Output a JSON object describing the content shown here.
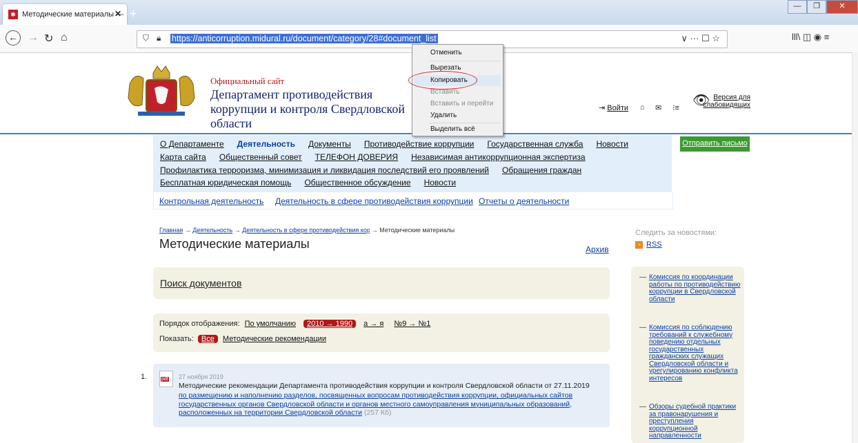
{
  "browser": {
    "tab_title": "Методические материалы —",
    "tab_close": "✕",
    "new_tab": "+",
    "url": "https://anticorruption.midural.ru/document/category/28#document_list",
    "url_right_icons": "∨  ···  ☐  ☆",
    "toolbar_right": "lll\\   ◫   ◉   ≡",
    "win_min": "—",
    "win_max": "❐",
    "win_close": "✕"
  },
  "header": {
    "small_title": "Официальный сайт",
    "title": "Департамент противодействия коррупции и контроля Свердловской области",
    "login": "Войти",
    "vision_version": "Версия для слабовидящих"
  },
  "menu": {
    "row1": [
      "О Департаменте",
      "Деятельность",
      "Документы",
      "Противодействие коррупции",
      "Государственная служба",
      "Новости"
    ],
    "row2": [
      "Карта сайта",
      "Общественный совет",
      "ТЕЛЕФОН ДОВЕРИЯ",
      "Независимая антикоррупционная экспертиза"
    ],
    "row3": [
      "Профилактика терроризма, минимизация и ликвидация последствий его проявлений",
      "Обращения граждан"
    ],
    "row4": [
      "Бесплатная юридическая помощь",
      "Общественное обсуждение",
      "Новости"
    ],
    "sub": [
      "Контрольная деятельность",
      "Деятельность в сфере противодействия коррупции",
      "Отчеты о деятельности"
    ],
    "send_letter": "Отправить письмо"
  },
  "breadcrumb": {
    "home": "Главная",
    "arrow": "→",
    "activity": "Деятельность",
    "sphere": "Деятельность в сфере противодействия коррупции",
    "current": "Методические материалы"
  },
  "page": {
    "title": "Методические материалы",
    "archive": "Архив",
    "search": "Поиск документов",
    "order_label": "Порядок отображения:",
    "order_default": "По умолчанию",
    "order_years": "2010 → 1990",
    "order_alpha": "а → я",
    "order_num": "№9 → №1",
    "show_label": "Показать:",
    "show_all": "Все",
    "show_recommend": "Методические рекомендации"
  },
  "document": {
    "index": "1.",
    "pdf": "pdf",
    "date": "27 ноября 2019",
    "title": "Методические рекомендации Департамента противодействия коррупции и контроля Свердловской области от 27.11.2019",
    "link_text": "по размещению и наполнению разделов, посвященных вопросам противодействия коррупции, официальных сайтов государственных органов Свердловской области и органов местного самоуправления муниципальных образований, расположенных на территории Свердловской области",
    "size": "(257 Кб)"
  },
  "sidebar": {
    "follow": "Следить за новостями:",
    "rss": "RSS",
    "dash": "—",
    "items": [
      "Комиссия по координации работы по противодействию коррупции в Свердловской области",
      "Комиссия по соблюдению требований к служебному поведению отдельных государственных гражданских служащих Свердловской области и урегулированию конфликта интересов",
      "Обзоры судебной практики за правонарушения и преступления коррупционной направленности"
    ]
  },
  "context_menu": {
    "undo": "Отменить",
    "cut": "Вырезать",
    "copy": "Копировать",
    "paste": "Вставить",
    "paste_go": "Вставить и перейти",
    "delete": "Удалить",
    "select_all": "Выделить всё"
  }
}
